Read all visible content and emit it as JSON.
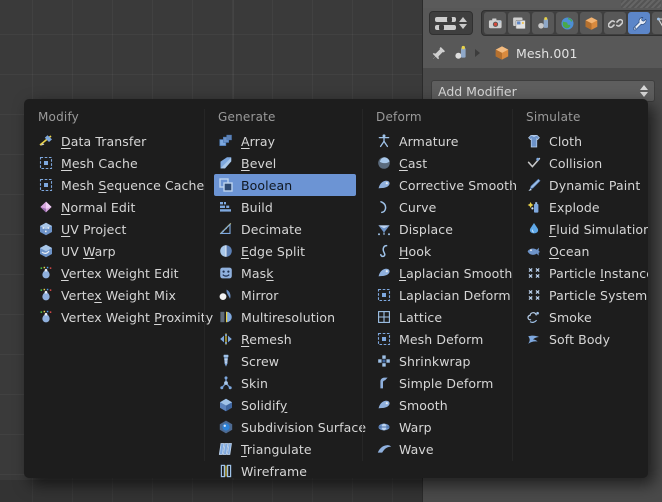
{
  "app": "Blender",
  "viewport": {
    "name": "3d-viewport",
    "grid": true,
    "bg_color": "#3a3a3a"
  },
  "properties_editor": {
    "editor_type": "properties-editor",
    "tabs": [
      {
        "id": "render",
        "icon": "camera-icon",
        "active": false
      },
      {
        "id": "render-layers",
        "icon": "images-icon",
        "active": false
      },
      {
        "id": "scene",
        "icon": "scene-icon",
        "active": false
      },
      {
        "id": "world",
        "icon": "globe-icon",
        "active": false
      },
      {
        "id": "object",
        "icon": "cube-icon",
        "active": false
      },
      {
        "id": "constraints",
        "icon": "chain-link-icon",
        "active": false
      },
      {
        "id": "modifiers",
        "icon": "wrench-icon",
        "active": true
      },
      {
        "id": "object-data",
        "icon": "mesh-triangle-icon",
        "active": false
      },
      {
        "id": "material",
        "icon": "material-ball-icon",
        "active": false
      },
      {
        "id": "texture",
        "icon": "checker-icon",
        "active": false
      }
    ],
    "breadcrumb": {
      "pin_icon": "pin-icon",
      "scene_icon": "scene-icon",
      "object_icon": "cube-icon",
      "object_name": "Mesh.001"
    },
    "add_modifier": {
      "label": "Add Modifier",
      "expanded": true
    }
  },
  "accent": {
    "highlight": "#6c94d4",
    "tab_active": "#5c86c9",
    "menu_bg": "#1d1d1d",
    "panel_bg": "#4a4a4a",
    "header_bg": "#585858"
  },
  "modifier_menu": {
    "name": "add-modifier-menu",
    "selected": "Boolean",
    "columns": [
      {
        "title": "Modify",
        "items": [
          {
            "label": "Data Transfer",
            "accel": "D",
            "icon": "data-transfer-icon"
          },
          {
            "label": "Mesh Cache",
            "accel": "M",
            "icon": "mesh-cache-icon"
          },
          {
            "label": "Mesh Sequence Cache",
            "accel": "S",
            "icon": "mesh-sequence-cache-icon"
          },
          {
            "label": "Normal Edit",
            "accel": "N",
            "icon": "normal-edit-icon"
          },
          {
            "label": "UV Project",
            "accel": "U",
            "icon": "uv-project-icon"
          },
          {
            "label": "UV Warp",
            "accel": "W",
            "icon": "uv-warp-icon"
          },
          {
            "label": "Vertex Weight Edit",
            "accel": "V",
            "icon": "vertex-weight-edit-icon"
          },
          {
            "label": "Vertex Weight Mix",
            "accel": "x",
            "icon": "vertex-weight-mix-icon"
          },
          {
            "label": "Vertex Weight Proximity",
            "accel": "P",
            "icon": "vertex-weight-proximity-icon"
          }
        ]
      },
      {
        "title": "Generate",
        "items": [
          {
            "label": "Array",
            "accel": "A",
            "icon": "array-icon"
          },
          {
            "label": "Bevel",
            "accel": "B",
            "icon": "bevel-icon"
          },
          {
            "label": "Boolean",
            "accel": "",
            "icon": "boolean-icon"
          },
          {
            "label": "Build",
            "accel": "",
            "icon": "build-icon"
          },
          {
            "label": "Decimate",
            "accel": "",
            "icon": "decimate-icon"
          },
          {
            "label": "Edge Split",
            "accel": "E",
            "icon": "edge-split-icon"
          },
          {
            "label": "Mask",
            "accel": "k",
            "icon": "mask-icon"
          },
          {
            "label": "Mirror",
            "accel": "",
            "icon": "mirror-icon"
          },
          {
            "label": "Multiresolution",
            "accel": "",
            "icon": "multiresolution-icon"
          },
          {
            "label": "Remesh",
            "accel": "R",
            "icon": "remesh-icon"
          },
          {
            "label": "Screw",
            "accel": "",
            "icon": "screw-icon"
          },
          {
            "label": "Skin",
            "accel": "",
            "icon": "skin-icon"
          },
          {
            "label": "Solidify",
            "accel": "y",
            "icon": "solidify-icon"
          },
          {
            "label": "Subdivision Surface",
            "accel": "",
            "icon": "subdivision-surface-icon"
          },
          {
            "label": "Triangulate",
            "accel": "T",
            "icon": "triangulate-icon"
          },
          {
            "label": "Wireframe",
            "accel": "",
            "icon": "wireframe-icon"
          }
        ]
      },
      {
        "title": "Deform",
        "items": [
          {
            "label": "Armature",
            "accel": "",
            "icon": "armature-icon"
          },
          {
            "label": "Cast",
            "accel": "C",
            "icon": "cast-icon"
          },
          {
            "label": "Corrective Smooth",
            "accel": "",
            "icon": "corrective-smooth-icon"
          },
          {
            "label": "Curve",
            "accel": "",
            "icon": "curve-icon"
          },
          {
            "label": "Displace",
            "accel": "",
            "icon": "displace-icon"
          },
          {
            "label": "Hook",
            "accel": "H",
            "icon": "hook-icon"
          },
          {
            "label": "Laplacian Smooth",
            "accel": "L",
            "icon": "laplacian-smooth-icon"
          },
          {
            "label": "Laplacian Deform",
            "accel": "",
            "icon": "laplacian-deform-icon"
          },
          {
            "label": "Lattice",
            "accel": "",
            "icon": "lattice-icon"
          },
          {
            "label": "Mesh Deform",
            "accel": "",
            "icon": "mesh-deform-icon"
          },
          {
            "label": "Shrinkwrap",
            "accel": "",
            "icon": "shrinkwrap-icon"
          },
          {
            "label": "Simple Deform",
            "accel": "",
            "icon": "simple-deform-icon"
          },
          {
            "label": "Smooth",
            "accel": "",
            "icon": "smooth-icon"
          },
          {
            "label": "Warp",
            "accel": "",
            "icon": "warp-icon"
          },
          {
            "label": "Wave",
            "accel": "",
            "icon": "wave-icon"
          }
        ]
      },
      {
        "title": "Simulate",
        "items": [
          {
            "label": "Cloth",
            "accel": "",
            "icon": "cloth-icon"
          },
          {
            "label": "Collision",
            "accel": "",
            "icon": "collision-icon"
          },
          {
            "label": "Dynamic Paint",
            "accel": "",
            "icon": "dynamic-paint-icon"
          },
          {
            "label": "Explode",
            "accel": "",
            "icon": "explode-icon"
          },
          {
            "label": "Fluid Simulation",
            "accel": "F",
            "icon": "fluid-simulation-icon"
          },
          {
            "label": "Ocean",
            "accel": "O",
            "icon": "ocean-icon"
          },
          {
            "label": "Particle Instance",
            "accel": "I",
            "icon": "particle-instance-icon"
          },
          {
            "label": "Particle System",
            "accel": "",
            "icon": "particle-system-icon"
          },
          {
            "label": "Smoke",
            "accel": "",
            "icon": "smoke-icon"
          },
          {
            "label": "Soft Body",
            "accel": "",
            "icon": "soft-body-icon"
          }
        ]
      }
    ]
  }
}
